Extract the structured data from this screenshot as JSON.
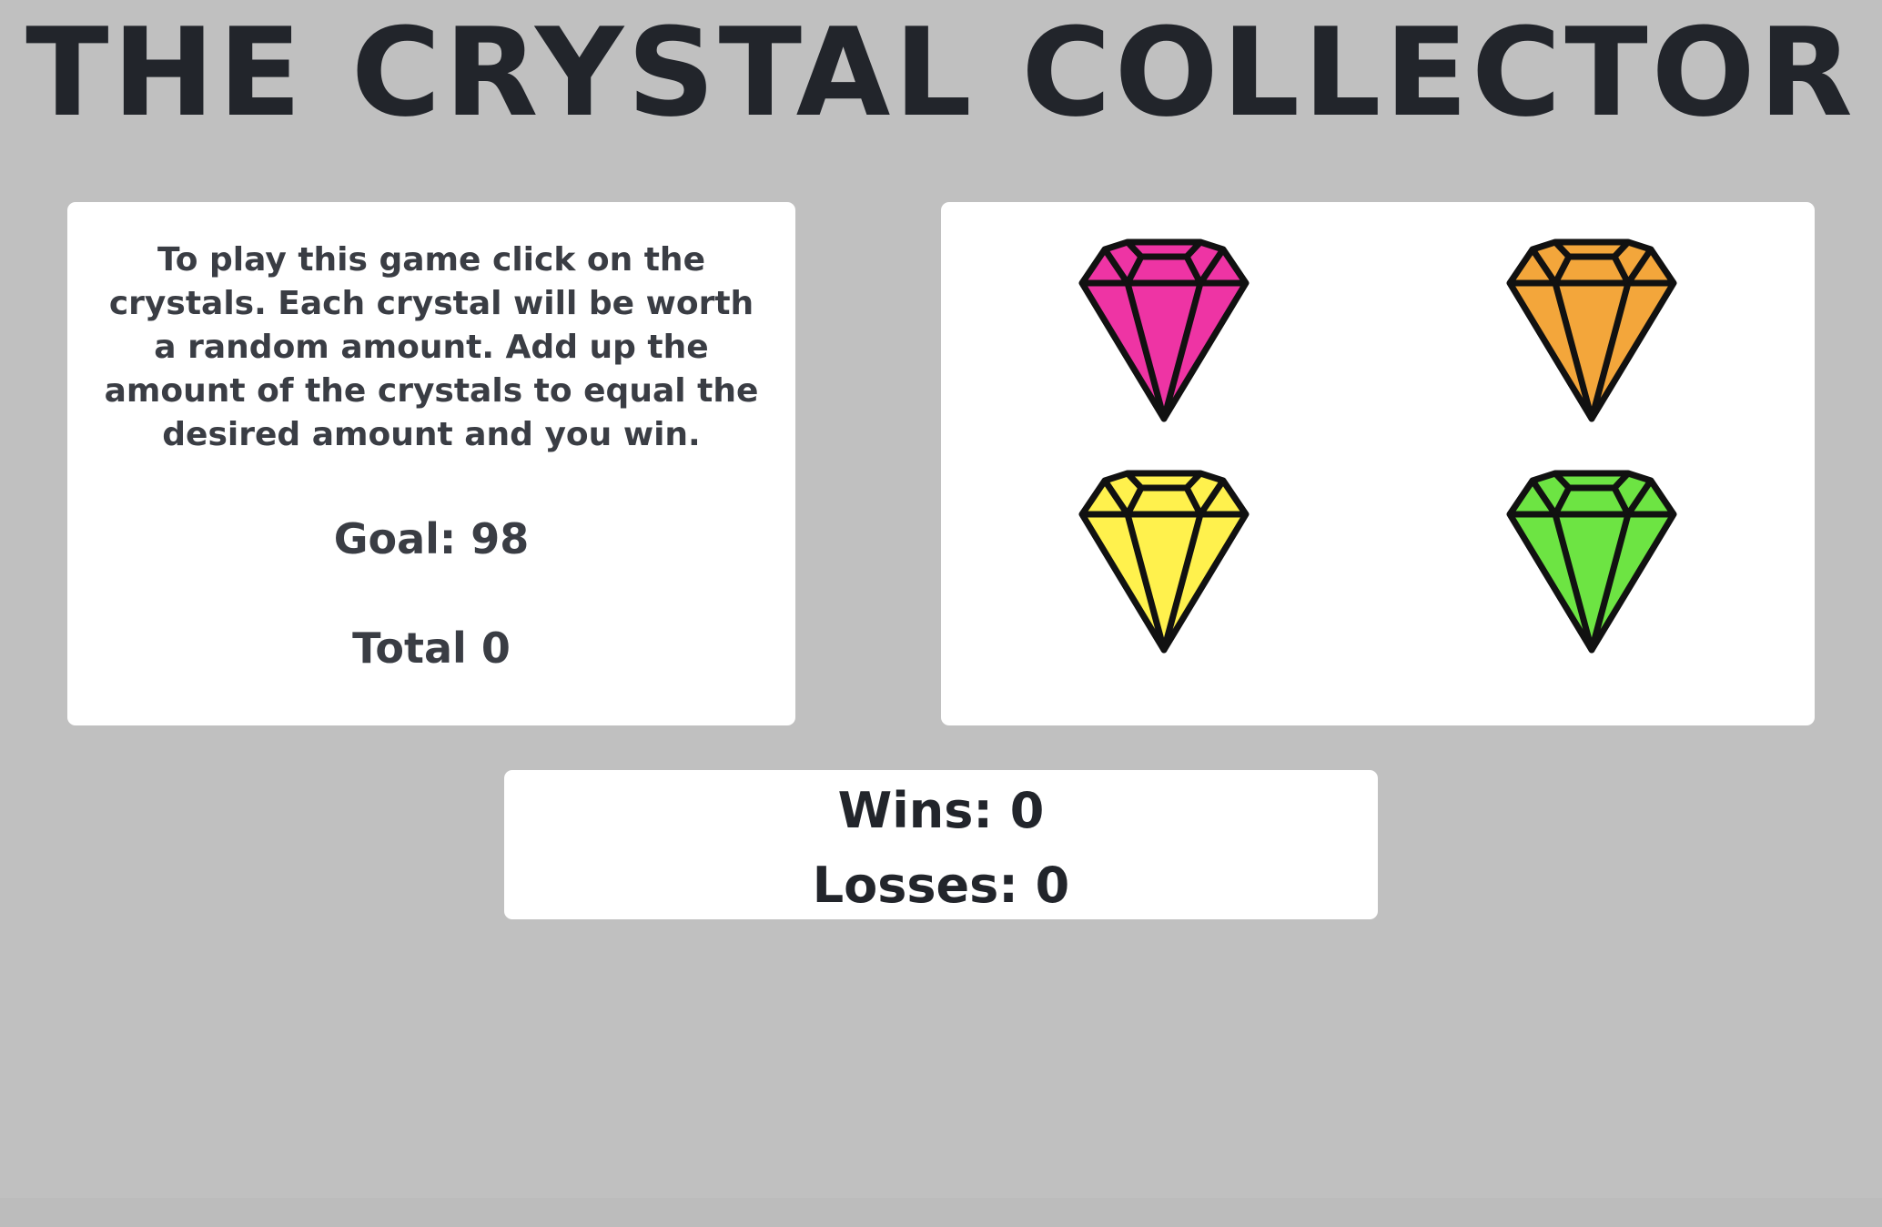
{
  "header": {
    "title": "THE CRYSTAL COLLECTOR"
  },
  "instructions": {
    "text": "To play this game click on the crystals. Each crystal will be worth a random amount. Add up the amount of the crystals to equal the desired amount and you win.",
    "goal_text": "Goal: 98",
    "total_text": "Total 0"
  },
  "crystals": [
    {
      "name": "pink",
      "color": "#ee34a4",
      "icon": "pink-crystal-icon"
    },
    {
      "name": "orange",
      "color": "#f3a63b",
      "icon": "orange-crystal-icon"
    },
    {
      "name": "yellow",
      "color": "#fff14d",
      "icon": "yellow-crystal-icon"
    },
    {
      "name": "green",
      "color": "#6de443",
      "icon": "green-crystal-icon"
    }
  ],
  "scoreboard": {
    "wins_text": "Wins: 0",
    "losses_text": "Losses: 0"
  },
  "colors": {
    "background": "#c0c0c0",
    "panel": "#ffffff",
    "text": "#22252b"
  }
}
